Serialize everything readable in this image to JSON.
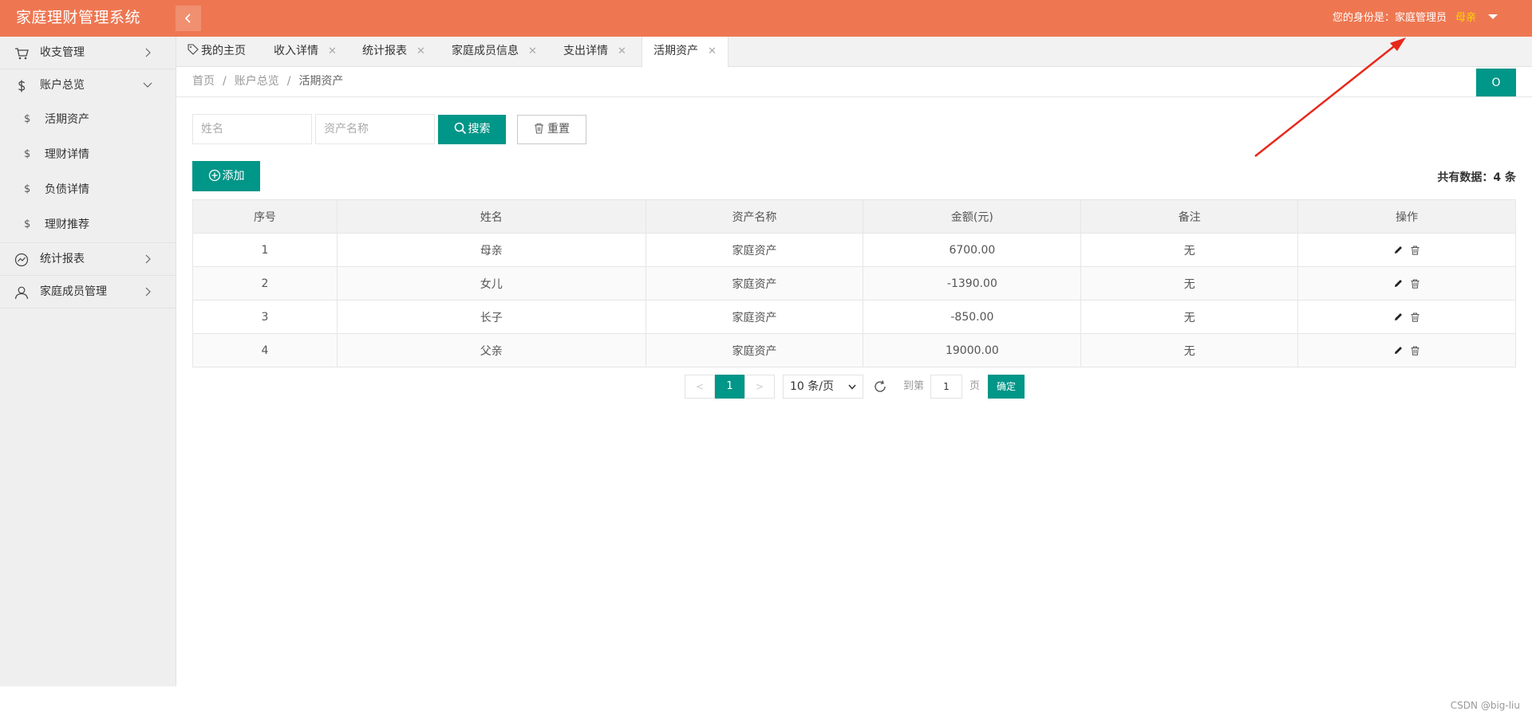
{
  "header": {
    "app_title": "家庭理财管理系统",
    "role_text": "您的身份是：家庭管理员",
    "user_name": "母亲"
  },
  "sidebar": {
    "menu": [
      {
        "label": "收支管理",
        "icon": "cart-icon"
      },
      {
        "label": "账户总览",
        "icon": "dollar-icon"
      },
      {
        "label": "统计报表",
        "icon": "chart-line-icon"
      },
      {
        "label": "家庭成员管理",
        "icon": "user-icon"
      }
    ],
    "submenu": [
      {
        "label": "活期资产",
        "icon": "dollar-icon"
      },
      {
        "label": "理财详情",
        "icon": "dollar-icon"
      },
      {
        "label": "负债详情",
        "icon": "dollar-icon"
      },
      {
        "label": "理财推荐",
        "icon": "dollar-icon"
      }
    ],
    "sub_icon_glyph": "$"
  },
  "tabs": [
    {
      "label": "我的主页",
      "closable": false
    },
    {
      "label": "收入详情",
      "closable": true
    },
    {
      "label": "统计报表",
      "closable": true
    },
    {
      "label": "家庭成员信息",
      "closable": true
    },
    {
      "label": "支出详情",
      "closable": true
    },
    {
      "label": "活期资产",
      "closable": true,
      "active": true
    }
  ],
  "tab_close_glyph": "✕",
  "breadcrumb": [
    "首页",
    "账户总览",
    "活期资产"
  ],
  "breadcrumb_sep": "/",
  "refresh_glyph": "O",
  "search": {
    "name_placeholder": "姓名",
    "asset_placeholder": "资产名称",
    "search_label": "搜索",
    "reset_label": "重置"
  },
  "toolbar": {
    "add_label": "添加",
    "total_label": "共有数据：",
    "total_count": "4",
    "total_unit": "条"
  },
  "table": {
    "columns": [
      "序号",
      "姓名",
      "资产名称",
      "金额(元)",
      "备注",
      "操作"
    ],
    "rows": [
      [
        "1",
        "母亲",
        "家庭资产",
        "6700.00",
        "无"
      ],
      [
        "2",
        "女儿",
        "家庭资产",
        "-1390.00",
        "无"
      ],
      [
        "3",
        "长子",
        "家庭资产",
        "-850.00",
        "无"
      ],
      [
        "4",
        "父亲",
        "家庭资产",
        "19000.00",
        "无"
      ]
    ]
  },
  "pagination": {
    "prev": "<",
    "current": "1",
    "next": ">",
    "page_size": "10 条/页",
    "goto_label": "到第",
    "goto_value": "1",
    "page_unit": "页",
    "confirm_label": "确定"
  },
  "watermark": "CSDN @big-liu",
  "colors": {
    "header": "#ee7752",
    "accent": "#009688",
    "username": "#ffd600",
    "annotation": "#e8281b"
  }
}
